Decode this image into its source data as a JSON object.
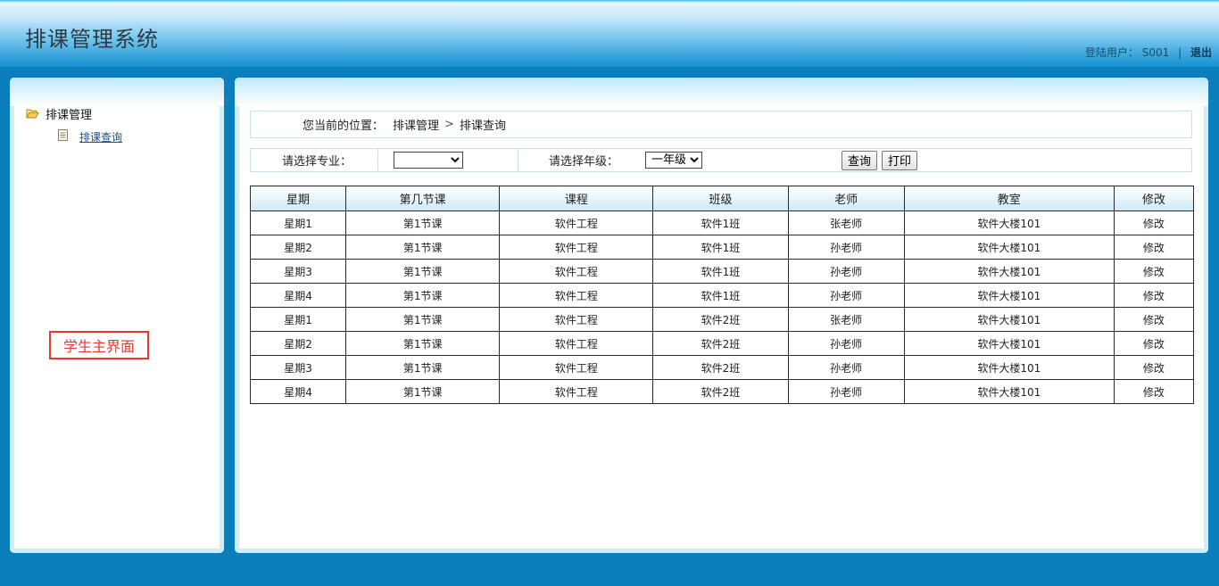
{
  "header": {
    "title": "排课管理系统",
    "user_label": "登陆用户：",
    "user_id": "S001",
    "separator": "|",
    "logout": "退出"
  },
  "sidebar": {
    "root_label": "排课管理",
    "child_label": "排课查询",
    "annotation": "学生主界面"
  },
  "breadcrumb": {
    "label": "您当前的位置：",
    "level1": "排课管理",
    "arrow": ">",
    "level2": "排课查询"
  },
  "filters": {
    "major_label": "请选择专业：",
    "major_value": "",
    "grade_label": "请选择年级：",
    "grade_value": "一年级",
    "query_button": "查询",
    "print_button": "打印"
  },
  "table": {
    "columns": [
      "星期",
      "第几节课",
      "课程",
      "班级",
      "老师",
      "教室",
      "修改"
    ],
    "rows": [
      [
        "星期1",
        "第1节课",
        "软件工程",
        "软件1班",
        "张老师",
        "软件大楼101",
        "修改"
      ],
      [
        "星期2",
        "第1节课",
        "软件工程",
        "软件1班",
        "孙老师",
        "软件大楼101",
        "修改"
      ],
      [
        "星期3",
        "第1节课",
        "软件工程",
        "软件1班",
        "孙老师",
        "软件大楼101",
        "修改"
      ],
      [
        "星期4",
        "第1节课",
        "软件工程",
        "软件1班",
        "孙老师",
        "软件大楼101",
        "修改"
      ],
      [
        "星期1",
        "第1节课",
        "软件工程",
        "软件2班",
        "张老师",
        "软件大楼101",
        "修改"
      ],
      [
        "星期2",
        "第1节课",
        "软件工程",
        "软件2班",
        "孙老师",
        "软件大楼101",
        "修改"
      ],
      [
        "星期3",
        "第1节课",
        "软件工程",
        "软件2班",
        "孙老师",
        "软件大楼101",
        "修改"
      ],
      [
        "星期4",
        "第1节课",
        "软件工程",
        "软件2班",
        "孙老师",
        "软件大楼101",
        "修改"
      ]
    ]
  },
  "colors": {
    "background": "#0a7fbb",
    "panel_border": "#cfeefc",
    "annotation": "#e8372f",
    "link": "#1d4f86"
  }
}
